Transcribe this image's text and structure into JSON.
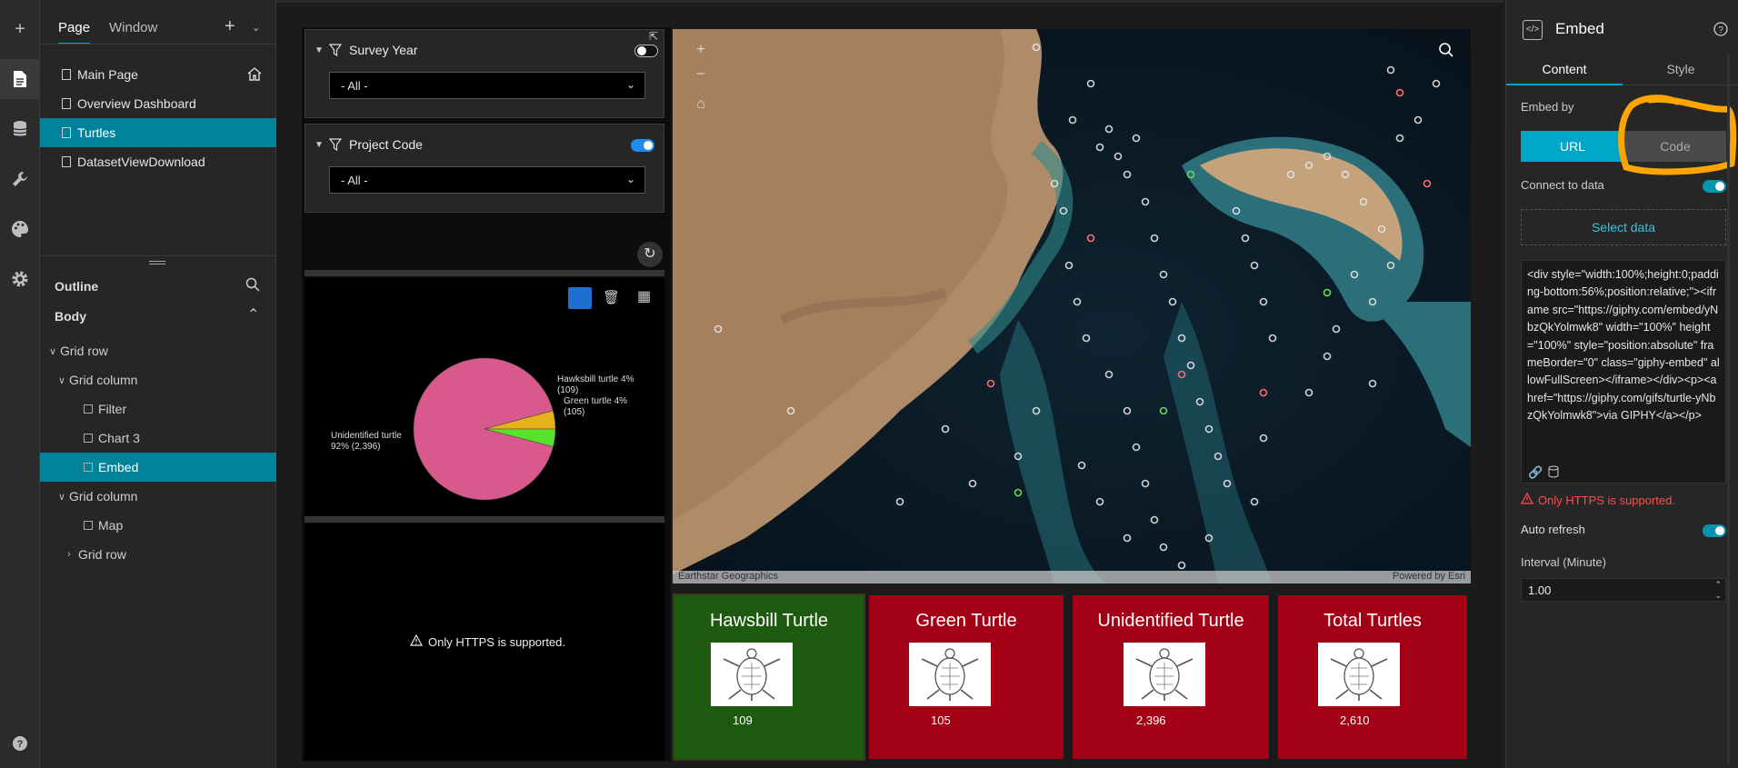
{
  "rail": {
    "icons": [
      "plus-icon",
      "page-icon",
      "data-icon",
      "widget-tools-icon",
      "theme-palette-icon",
      "settings-gear-icon",
      "help-icon"
    ]
  },
  "page_panel": {
    "tabs": [
      "Page",
      "Window"
    ],
    "pages": [
      "Main Page",
      "Overview Dashboard",
      "Turtles",
      "DatasetViewDownload"
    ],
    "selected_page": "Turtles",
    "outline_title": "Outline",
    "outline_root": "Body",
    "outline": [
      {
        "label": "Grid row",
        "indent": 0,
        "expander": "v"
      },
      {
        "label": "Grid column",
        "indent": 1,
        "expander": "v"
      },
      {
        "label": "Filter",
        "indent": 2,
        "expander": ""
      },
      {
        "label": "Chart 3",
        "indent": 2,
        "expander": ""
      },
      {
        "label": "Embed",
        "indent": 2,
        "expander": "",
        "selected": true
      },
      {
        "label": "Grid column",
        "indent": 1,
        "expander": "v"
      },
      {
        "label": "Map",
        "indent": 2,
        "expander": ""
      },
      {
        "label": "Grid row",
        "indent": 2,
        "expander": ">"
      }
    ]
  },
  "filters": [
    {
      "label": "Survey Year",
      "value": "- All -",
      "toggle": "off"
    },
    {
      "label": "Project Code",
      "value": "- All -",
      "toggle": "on"
    }
  ],
  "chart_data": {
    "type": "pie",
    "title": "",
    "slices": [
      {
        "label": "Unidentified turtle",
        "percent": "92%",
        "value": 2396,
        "value_label": "(2,396)",
        "color": "#d9598d"
      },
      {
        "label": "Hawksbill turtle",
        "percent": "4%",
        "value": 109,
        "value_label": "(109)",
        "color": "#e6b21a"
      },
      {
        "label": "Green turtle",
        "percent": "4%",
        "value": 105,
        "value_label": "(105)",
        "color": "#58e22b"
      }
    ]
  },
  "embed_warning": "Only HTTPS is supported.",
  "map": {
    "attribution_left": "Earthstar Geographics",
    "attribution_right": "Powered by Esri"
  },
  "cards": [
    {
      "title": "Hawsbill Turtle",
      "value": "109",
      "color": "#1e5a0f"
    },
    {
      "title": "Green Turtle",
      "value": "105",
      "color": "#a30016"
    },
    {
      "title": "Unidentified Turtle",
      "value": "2,396",
      "color": "#a30016"
    },
    {
      "title": "Total Turtles",
      "value": "2,610",
      "color": "#a30016"
    }
  ],
  "right_panel": {
    "title": "Embed",
    "tabs": [
      "Content",
      "Style"
    ],
    "embed_by_label": "Embed by",
    "embed_options": [
      "URL",
      "Code"
    ],
    "connect_label": "Connect to data",
    "select_data": "Select data",
    "code": "<div style=\"width:100%;height:0;padding-bottom:56%;position:relative;\"><iframe src=\"https://giphy.com/embed/yNbzQkYolmwk8\" width=\"100%\" height=\"100%\" style=\"position:absolute\" frameBorder=\"0\" class=\"giphy-embed\" allowFullScreen></iframe></div><p><a href=\"https://giphy.com/gifs/turtle-yNbzQkYolmwk8\">via GIPHY</a></p>",
    "warning": "Only HTTPS is supported.",
    "auto_refresh_label": "Auto refresh",
    "interval_label": "Interval (Minute)",
    "interval_value": "1.00"
  }
}
